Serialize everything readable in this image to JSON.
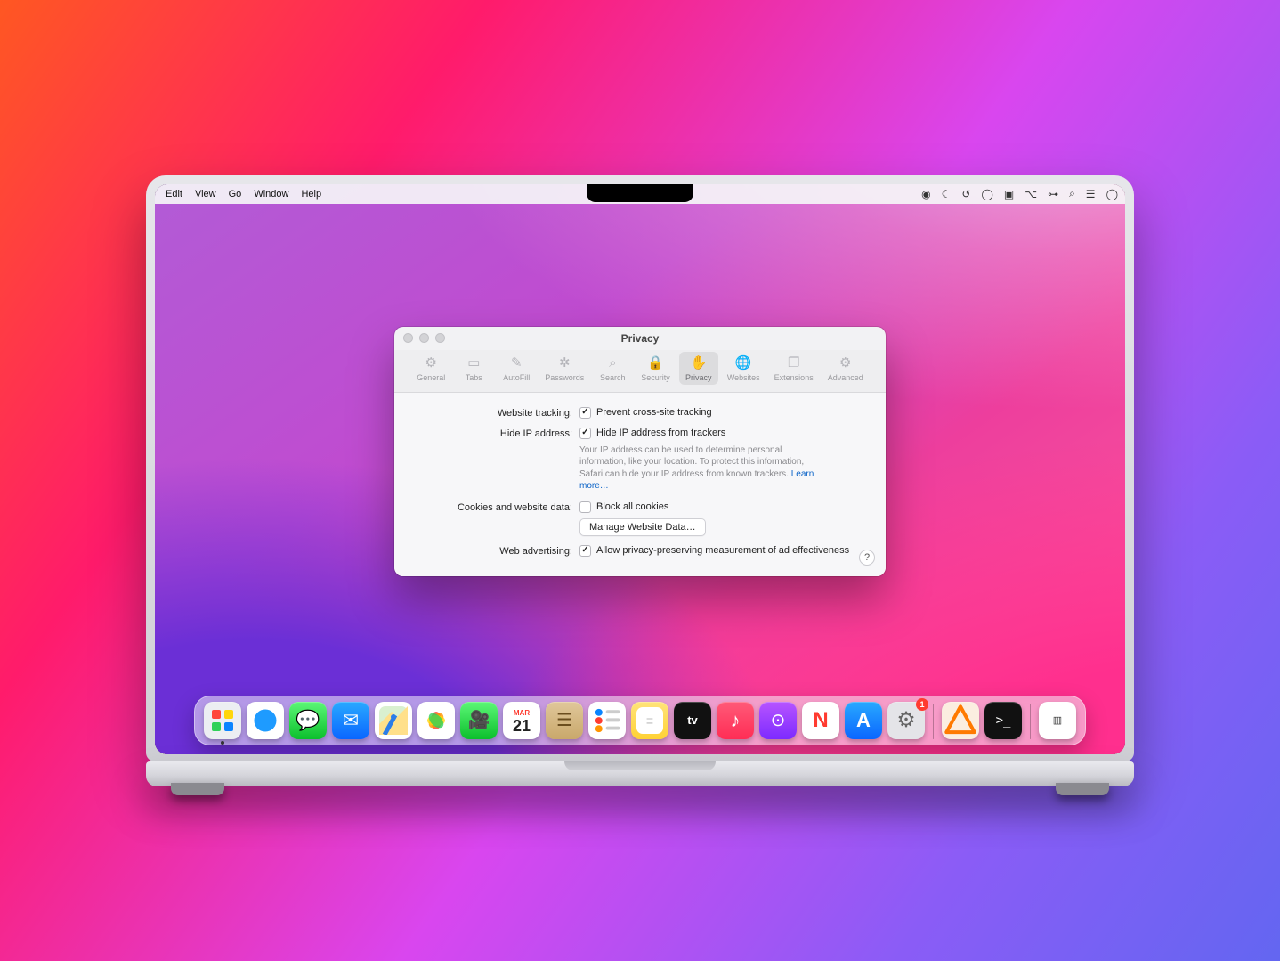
{
  "menubar": {
    "items": [
      "Edit",
      "View",
      "Go",
      "Window",
      "Help"
    ]
  },
  "menubar_right_icons": [
    "record",
    "moon",
    "clock",
    "user",
    "layers",
    "control",
    "wifi",
    "search",
    "menu",
    "siri"
  ],
  "pref": {
    "title": "Privacy",
    "tabs": [
      {
        "id": "general",
        "label": "General"
      },
      {
        "id": "tabs",
        "label": "Tabs"
      },
      {
        "id": "autofill",
        "label": "AutoFill"
      },
      {
        "id": "passwords",
        "label": "Passwords"
      },
      {
        "id": "search",
        "label": "Search"
      },
      {
        "id": "security",
        "label": "Security"
      },
      {
        "id": "privacy",
        "label": "Privacy"
      },
      {
        "id": "websites",
        "label": "Websites"
      },
      {
        "id": "extensions",
        "label": "Extensions"
      },
      {
        "id": "advanced",
        "label": "Advanced"
      }
    ],
    "active_tab": "privacy",
    "rows": {
      "tracking": {
        "label": "Website tracking:",
        "check": "Prevent cross-site tracking",
        "checked": true
      },
      "hideip": {
        "label": "Hide IP address:",
        "check": "Hide IP address from trackers",
        "checked": true,
        "desc": "Your IP address can be used to determine personal information, like your location. To protect this information, Safari can hide your IP address from known trackers. ",
        "learn": "Learn more…"
      },
      "cookies": {
        "label": "Cookies and website data:",
        "check": "Block all cookies",
        "checked": false,
        "button": "Manage Website Data…"
      },
      "ads": {
        "label": "Web advertising:",
        "check": "Allow privacy-preserving measurement of ad effectiveness",
        "checked": true
      }
    },
    "help": "?"
  },
  "calendar": {
    "month": "MAR",
    "day": "21"
  },
  "settings_badge": "1"
}
